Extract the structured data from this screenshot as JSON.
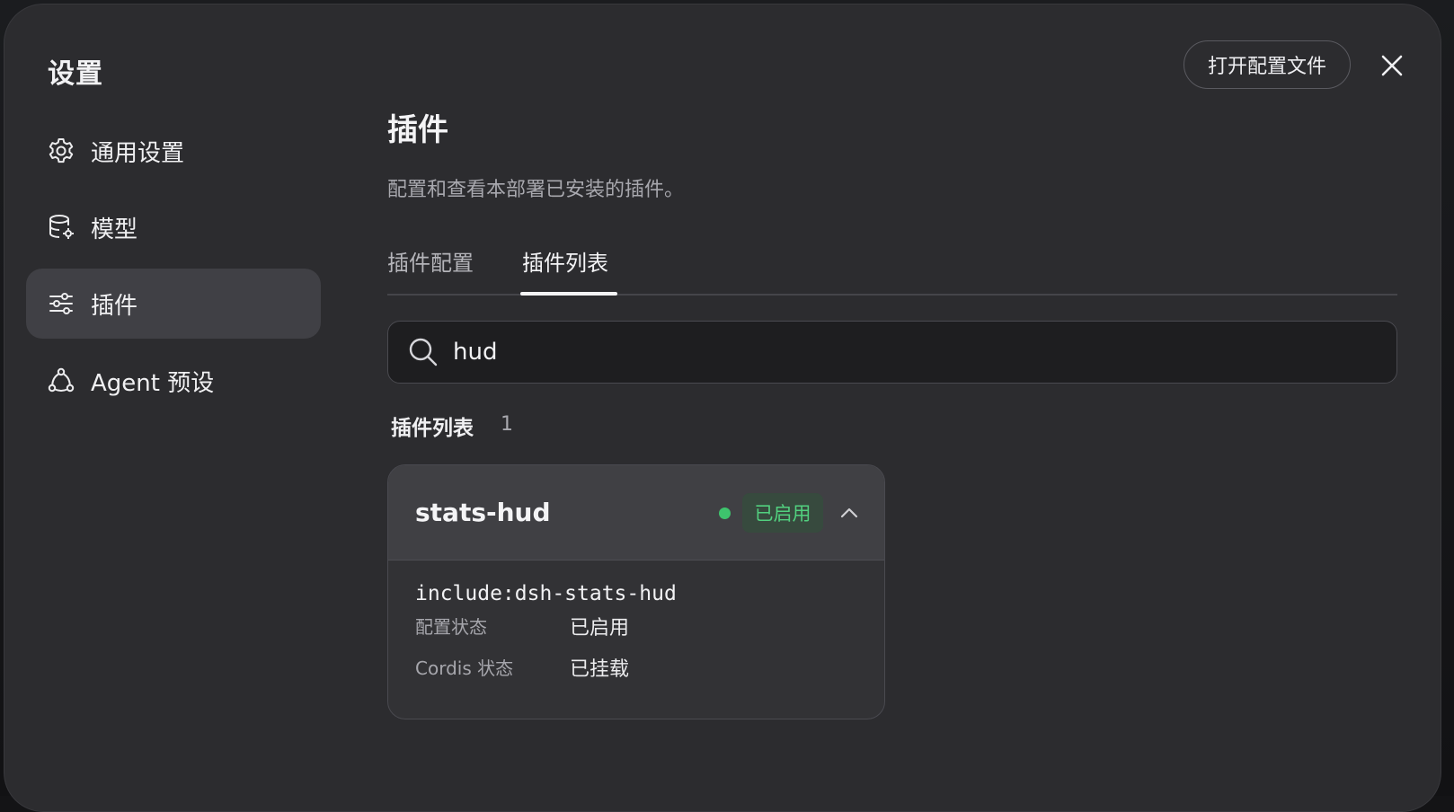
{
  "dialog": {
    "title": "设置",
    "open_config_label": "打开配置文件"
  },
  "sidebar": {
    "items": [
      {
        "label": "通用设置",
        "icon": "gear-icon",
        "active": false
      },
      {
        "label": "模型",
        "icon": "database-gear-icon",
        "active": false
      },
      {
        "label": "插件",
        "icon": "sliders-icon",
        "active": true
      },
      {
        "label": "Agent 预设",
        "icon": "agent-nodes-icon",
        "active": false
      }
    ]
  },
  "main": {
    "title": "插件",
    "description": "配置和查看本部署已安装的插件。",
    "tabs": [
      {
        "label": "插件配置",
        "active": false
      },
      {
        "label": "插件列表",
        "active": true
      }
    ],
    "search": {
      "value": "hud"
    },
    "list": {
      "heading": "插件列表",
      "count": "1"
    }
  },
  "plugins": [
    {
      "name": "stats-hud",
      "status": "已启用",
      "include": "include:dsh-stats-hud",
      "config_state_label": "配置状态",
      "config_state_value": "已启用",
      "cordis_state_label": "Cordis 状态",
      "cordis_state_value": "已挂载"
    }
  ],
  "colors": {
    "dialog_bg": "#2c2c2f",
    "active_item_bg": "#404045",
    "status_green": "#3ec46d"
  }
}
